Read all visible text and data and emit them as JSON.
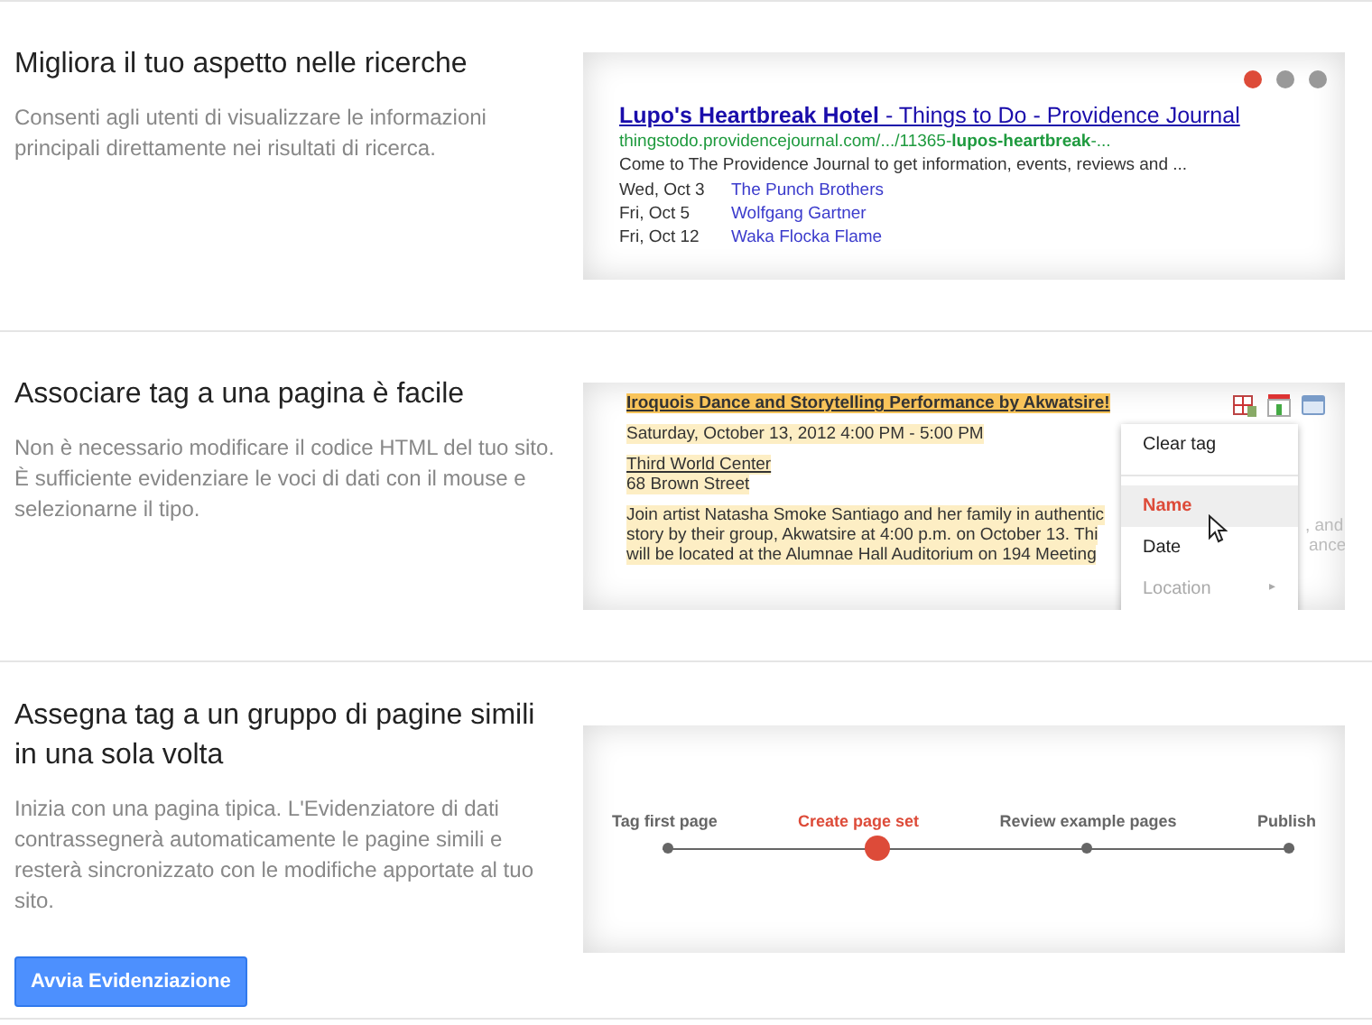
{
  "sections": [
    {
      "title": "Migliora il tuo aspetto nelle ricerche",
      "description": "Consenti agli utenti di visualizzare le informazioni principali direttamente nei risultati di ricerca.",
      "kind": "search"
    },
    {
      "title": "Associare tag a una pagina è facile",
      "description": "Non è necessario modificare il codice HTML del tuo sito. È sufficiente evidenziare le voci di dati con il mouse e selezionarne il tipo.",
      "kind": "tagging"
    },
    {
      "title": "Assegna tag a un gruppo di pagine simili in una sola volta",
      "description": "Inizia con una pagina tipica. L'Evidenziatore di dati contrassegnerà automaticamente le pagine simili e resterà sincronizzato con le modifiche apportate al tuo sito.",
      "kind": "steps",
      "button": "Avvia Evidenziazione"
    }
  ],
  "search_result": {
    "dots": [
      {
        "selected": true
      },
      {
        "selected": false
      },
      {
        "selected": false
      }
    ],
    "title": "**Lupo's Heartbreak Hotel** - Things to Do - Providence Journal",
    "url": "thingstodo.providencejournal.com/.../11365-**lupos-heartbreak**-...",
    "snippet": "Come to The Providence Journal to get information, events, reviews and ...",
    "events": [
      {
        "date": "Wed, Oct 3",
        "name": "The Punch Brothers"
      },
      {
        "date": "Fri, Oct 5",
        "name": "Wolfgang Gartner"
      },
      {
        "date": "Fri, Oct 12",
        "name": "Waka Flocka Flame"
      }
    ]
  },
  "tagging": {
    "title": "Iroquois Dance and Storytelling Performance by Akwatsire!",
    "datetime": "Saturday, October 13, 2012 4:00 PM - 5:00 PM",
    "venue": "Third World Center",
    "address": "68 Brown Street",
    "body": [
      "Join artist Natasha Smoke Santiago and her family in authentic",
      "story by their group, Akwatsire at 4:00 p.m. on October 13. Thi",
      "will be located at the Alumnae Hall Auditorium on 194 Meeting"
    ],
    "body_tails": [
      ", and",
      "ance"
    ],
    "menu": [
      {
        "label": "Clear tag",
        "selected": false,
        "disabled": false,
        "submenu": false
      },
      {
        "label": "Name",
        "selected": true,
        "disabled": false,
        "submenu": false
      },
      {
        "label": "Date",
        "selected": false,
        "disabled": false,
        "submenu": false
      },
      {
        "label": "Location",
        "selected": false,
        "disabled": true,
        "submenu": true
      }
    ],
    "submenu_arrow": "▸"
  },
  "steps": [
    {
      "label": "Tag first page",
      "selected": false
    },
    {
      "label": "Create page set",
      "selected": true
    },
    {
      "label": "Review example pages",
      "selected": false
    },
    {
      "label": "Publish",
      "selected": false
    }
  ]
}
